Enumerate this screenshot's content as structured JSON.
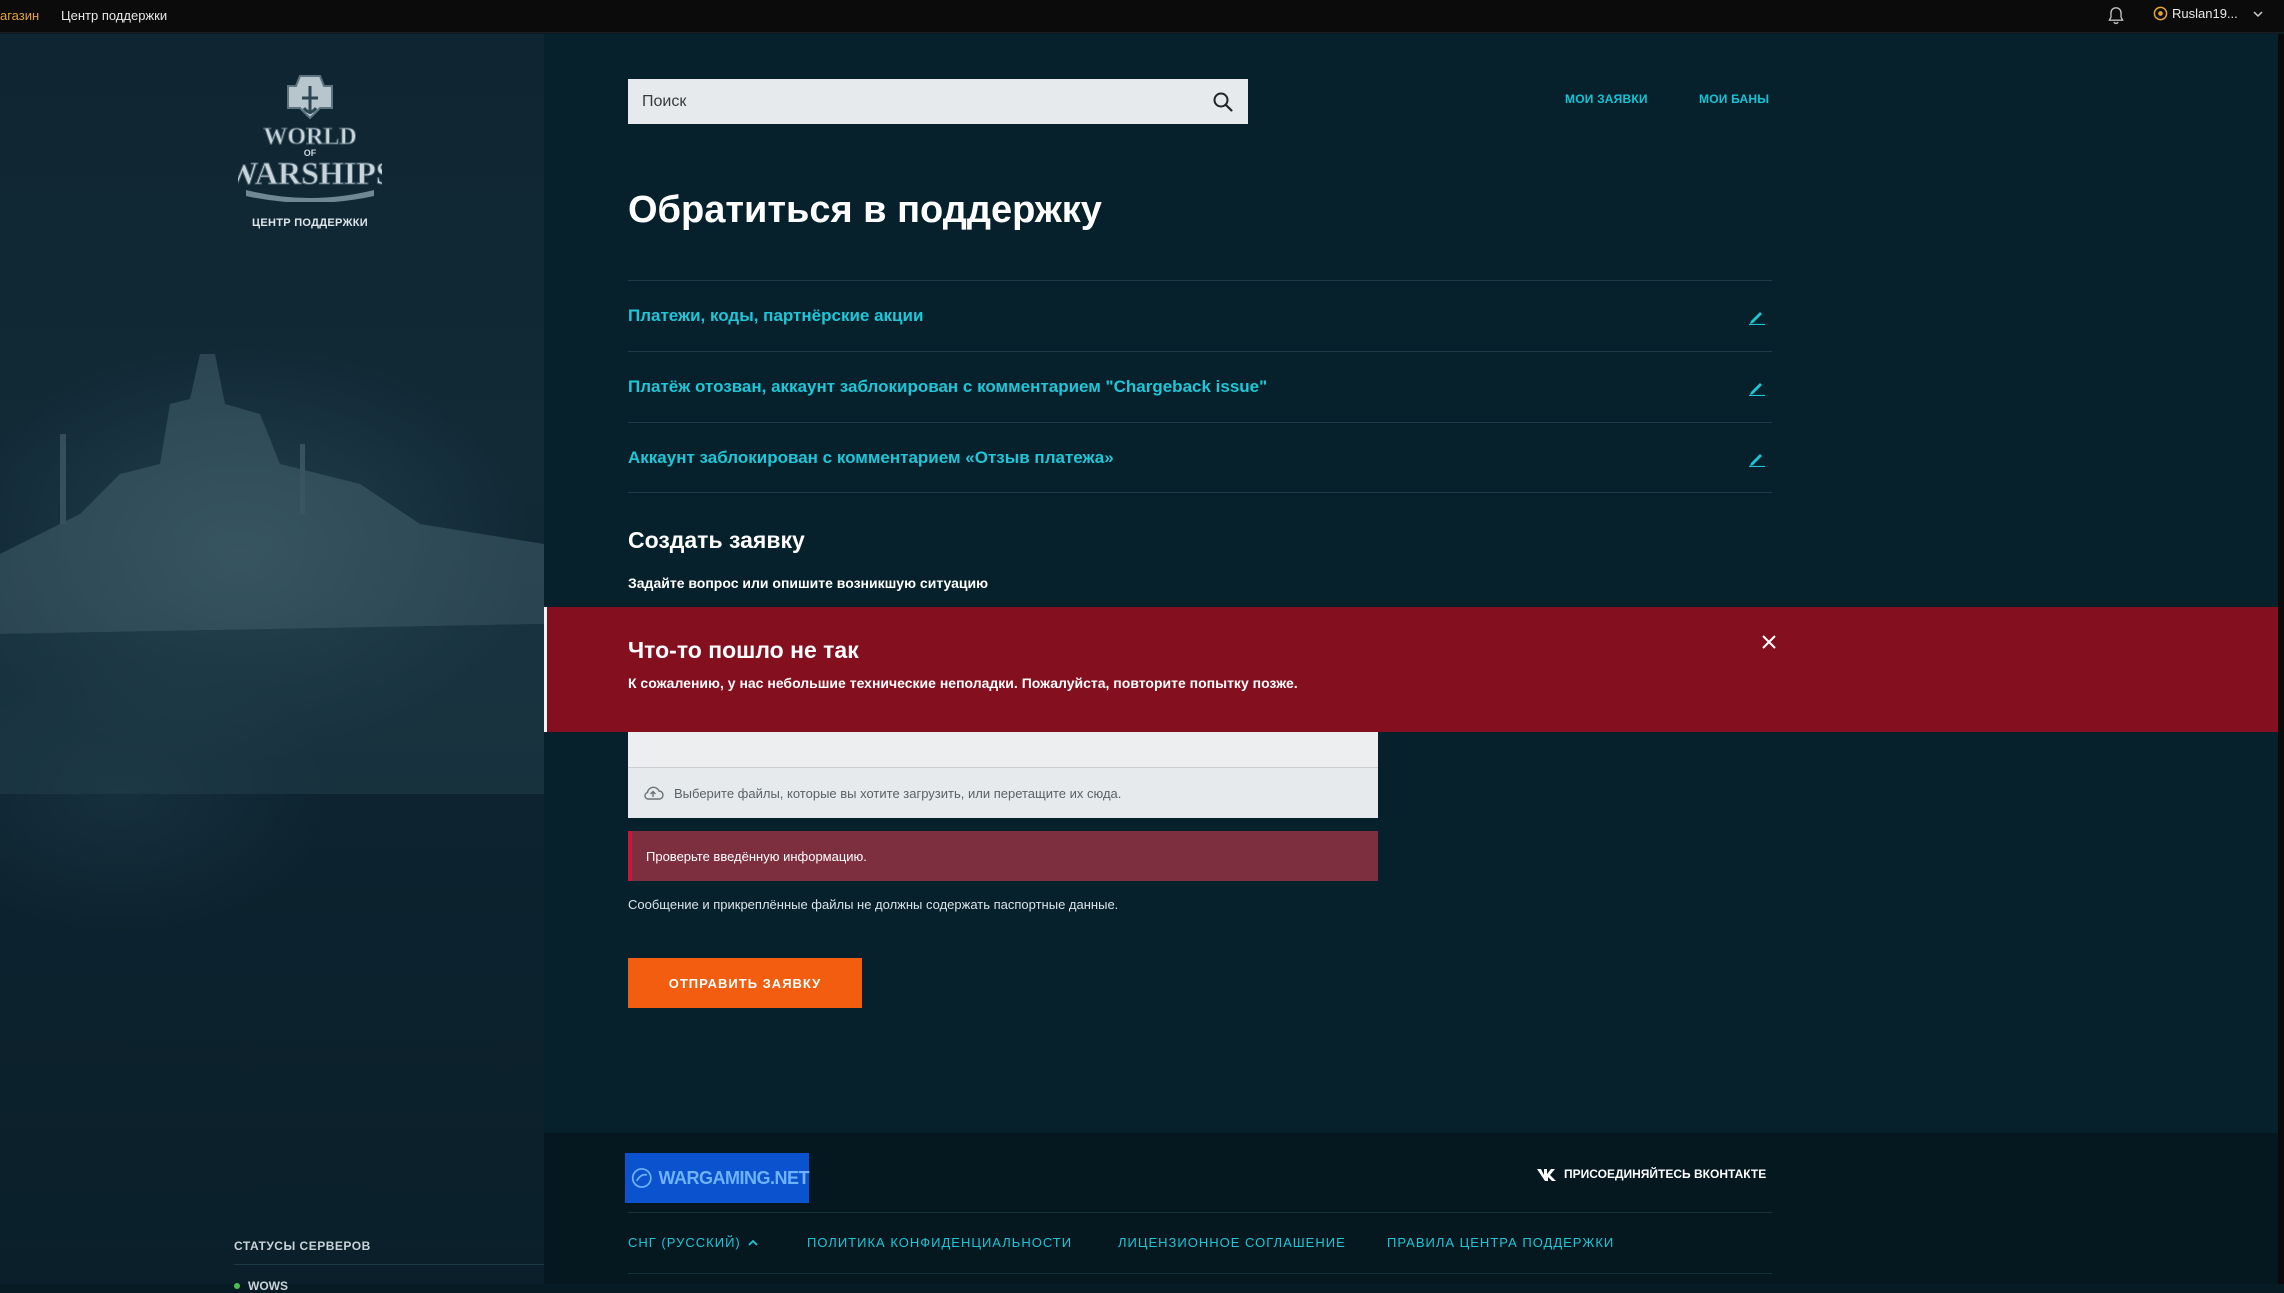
{
  "topbar": {
    "shop_label": "агазин",
    "support_label": "Центр поддержки",
    "user_name": "Ruslan19..."
  },
  "sidebar": {
    "logo_text": "WORLD OF WARSHIPS",
    "logo_caption": "ЦЕНТР ПОДДЕРЖКИ",
    "status_title": "СТАТУСЫ СЕРВЕРОВ",
    "server_name": "WOWS",
    "server_status_color": "#4cc04c"
  },
  "header": {
    "search_placeholder": "Поиск",
    "my_requests": "МОИ ЗАЯВКИ",
    "my_bans": "МОИ БАНЫ"
  },
  "page": {
    "title": "Обратиться в поддержку",
    "faq_items": [
      {
        "label": "Платежи, коды, партнёрские акции"
      },
      {
        "label": "Платёж отозван, аккаунт заблокирован с комментарием \"Chargeback issue\""
      },
      {
        "label": "Аккаунт заблокирован с комментарием «Отзыв платежа»"
      }
    ],
    "create_title": "Создать заявку",
    "create_subtitle": "Задайте вопрос или опишите возникшую ситуацию",
    "upload_hint": "Выберите файлы, которые вы хотите загрузить, или перетащите их сюда.",
    "field_error": "Проверьте введённую информацию.",
    "notice": "Сообщение и прикреплённые файлы не должны содержать паспортные данные.",
    "submit_label": "ОТПРАВИТЬ ЗАЯВКУ"
  },
  "alert": {
    "title": "Что-то пошло не так",
    "text": "К сожалению, у нас небольшие технические неполадки. Пожалуйста, повторите попытку позже.",
    "bg_color": "#84101f"
  },
  "footer": {
    "wg_logo_text": "WARGAMING.NET",
    "vk_label": "ПРИСОЕДИНЯЙТЕСЬ ВКОНТАКТЕ",
    "region": "СНГ (РУССКИЙ)",
    "privacy": "ПОЛИТИКА КОНФИДЕНЦИАЛЬНОСТИ",
    "license": "ЛИЦЕНЗИОННОЕ СОГЛАШЕНИЕ",
    "rules": "ПРАВИЛА ЦЕНТРА ПОДДЕРЖКИ"
  },
  "colors": {
    "accent": "#1ec6d7",
    "button": "#f25d0f",
    "background": "#07212c"
  }
}
